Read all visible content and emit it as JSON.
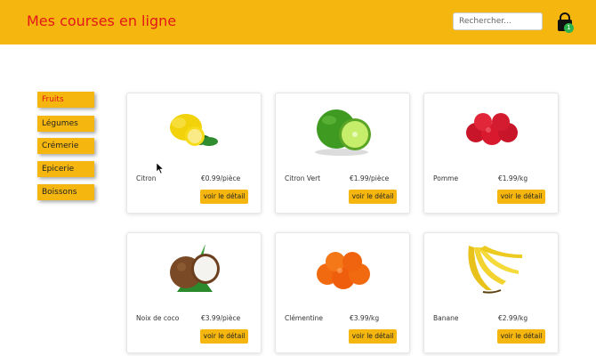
{
  "header": {
    "title": "Mes courses en ligne",
    "search_placeholder": "Rechercher...",
    "cart_count": "1"
  },
  "sidebar": {
    "items": [
      {
        "label": "Fruits",
        "active": true
      },
      {
        "label": "Légumes",
        "active": false
      },
      {
        "label": "Crémerie",
        "active": false
      },
      {
        "label": "Epicerie",
        "active": false
      },
      {
        "label": "Boissons",
        "active": false
      }
    ]
  },
  "products": [
    {
      "name": "Citron",
      "price": "€0.99/pièce",
      "button": "voir le détail",
      "image": "lemon"
    },
    {
      "name": "Citron Vert",
      "price": "€1.99/pièce",
      "button": "voir le détail",
      "image": "lime"
    },
    {
      "name": "Pomme",
      "price": "€1.99/kg",
      "button": "voir le détail",
      "image": "apple"
    },
    {
      "name": "Noix de coco",
      "price": "€3.99/pièce",
      "button": "voir le détail",
      "image": "coconut"
    },
    {
      "name": "Clémentine",
      "price": "€3.99/kg",
      "button": "voir le détail",
      "image": "clementine"
    },
    {
      "name": "Banane",
      "price": "€2.99/kg",
      "button": "voir le détail",
      "image": "banana"
    }
  ],
  "colors": {
    "header_bg": "#f5b70f",
    "brand_red": "#e3161a",
    "badge_green": "#2db34a"
  }
}
